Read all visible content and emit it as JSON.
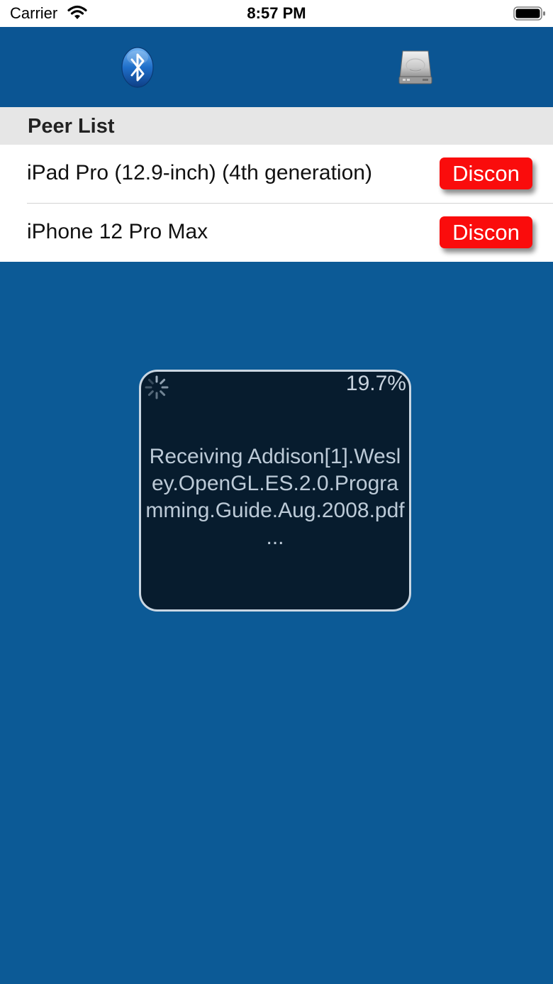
{
  "status_bar": {
    "carrier": "Carrier",
    "time": "8:57 PM",
    "wifi_icon": "wifi-icon",
    "battery_icon": "battery-full-icon"
  },
  "toolbar": {
    "bluetooth_icon": "bluetooth-icon",
    "drive_icon": "hard-drive-icon",
    "background_color": "#0b5593"
  },
  "peer_list": {
    "header": "Peer List",
    "peers": [
      {
        "name": "iPad Pro (12.9-inch) (4th generation)",
        "button_label": "Discon"
      },
      {
        "name": "iPhone 12 Pro Max",
        "button_label": "Discon"
      }
    ]
  },
  "progress": {
    "percent": "19.7%",
    "message": "Receiving Addison[1].Wesley.OpenGL.ES.2.0.Programming.Guide.Aug.2008.pdf ...",
    "spinner_icon": "activity-spinner-icon"
  },
  "colors": {
    "background": "#0c5a96",
    "button_red": "#fa0c0c",
    "hud_background": "#071c2e"
  }
}
